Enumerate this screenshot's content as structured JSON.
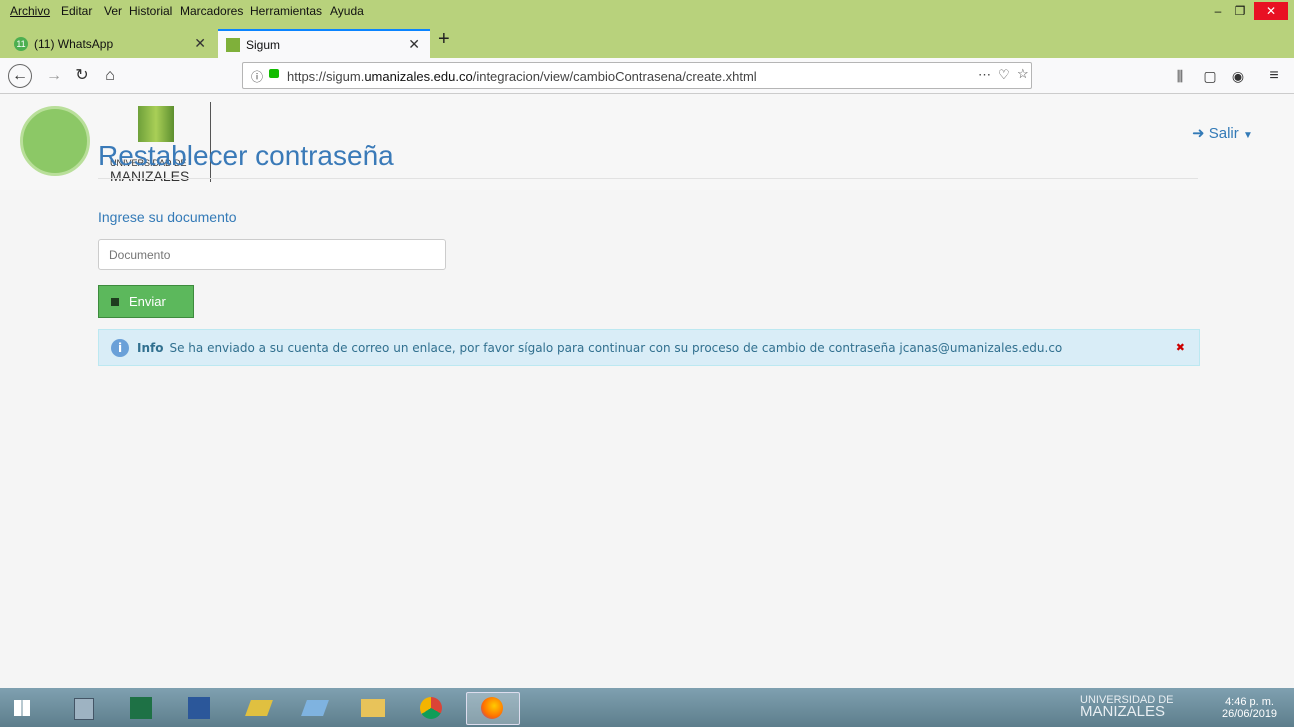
{
  "menu": [
    "Archivo",
    "Editar",
    "Ver",
    "Historial",
    "Marcadores",
    "Herramientas",
    "Ayuda"
  ],
  "tabs": [
    {
      "label": "(11) WhatsApp",
      "badge": "11"
    },
    {
      "label": "Sigum"
    }
  ],
  "url": {
    "prefix": "https://sigum.",
    "domain": "umanizales.edu.co",
    "path": "/integracion/view/cambioContrasena/create.xhtml"
  },
  "header": {
    "logo_line1": "UNIVERSIDAD DE",
    "logo_line2": "MANIZALES",
    "logout": "Salir"
  },
  "main": {
    "title": "Restablecer contraseña",
    "doc_label": "Ingrese su documento",
    "doc_placeholder": "Documento",
    "submit": "Enviar"
  },
  "alert": {
    "title": "Info",
    "message": "Se ha enviado a su cuenta de correo un enlace, por favor sígalo para continuar con su proceso de cambio de contraseña jcanas@umanizales.edu.co"
  },
  "taskbar": {
    "time": "4:46 p. m.",
    "date": "26/06/2019"
  },
  "colors": {
    "chrome": "#b8d27c",
    "accent": "#3a7ab8",
    "button": "#5cb85c",
    "alert_bg": "#d9edf7"
  }
}
